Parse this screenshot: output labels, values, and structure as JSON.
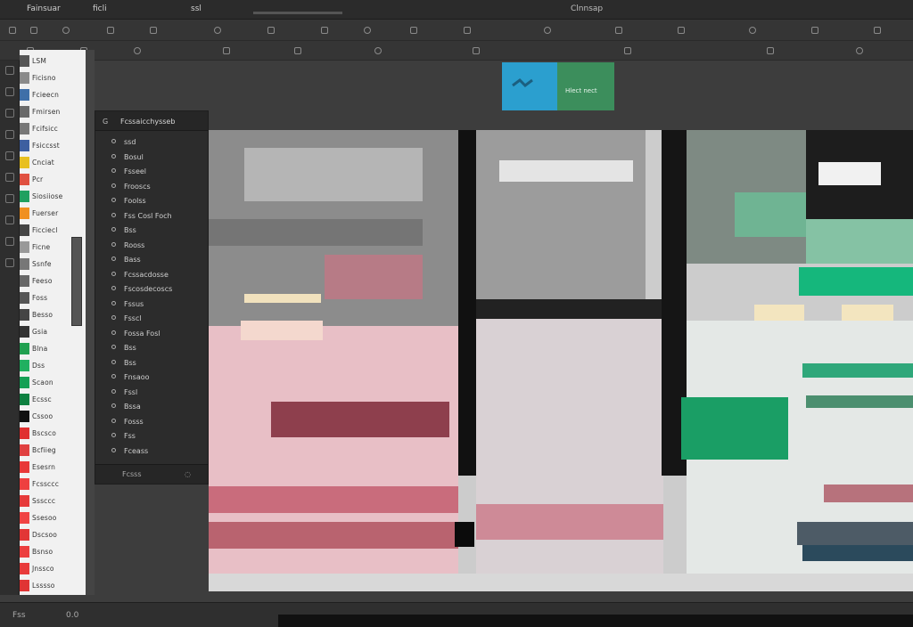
{
  "menubar": {
    "app_menu": "Fainsuar",
    "item_a": "ficli",
    "item_b": "ssl",
    "doc_title": "Clnnsap"
  },
  "toolbar": {
    "colors": {
      "bg": "#353535",
      "icon": "#8a8a8a"
    }
  },
  "top_badges": {
    "blue_icon": "wave-icon",
    "green_label": "Hlect nect",
    "colors": {
      "blue": "#2b9fcf",
      "green": "#3c8e5c"
    }
  },
  "swatches": [
    {
      "label": "LSM",
      "color": "#555555"
    },
    {
      "label": "Ficisno",
      "color": "#8a8a8a"
    },
    {
      "label": "Fcieecn",
      "color": "#3f6fa8"
    },
    {
      "label": "Fmirsen",
      "color": "#6a6a6a"
    },
    {
      "label": "Fcifsicc",
      "color": "#777777"
    },
    {
      "label": "Fsiccsst",
      "color": "#3d5fa0"
    },
    {
      "label": "Cnciat",
      "color": "#e8c020"
    },
    {
      "label": "Pcr",
      "color": "#e05040"
    },
    {
      "label": "Siosiiose",
      "color": "#20a060"
    },
    {
      "label": "Fuerser",
      "color": "#f09020"
    },
    {
      "label": "Ficciecl",
      "color": "#444444"
    },
    {
      "label": "Ficne",
      "color": "#999999"
    },
    {
      "label": "Ssnfe",
      "color": "#777777"
    },
    {
      "label": "Feeso",
      "color": "#666666"
    },
    {
      "label": "Foss",
      "color": "#555555"
    },
    {
      "label": "Besso",
      "color": "#444444"
    },
    {
      "label": "Gsia",
      "color": "#333333"
    },
    {
      "label": "Blna",
      "color": "#20a050"
    },
    {
      "label": "Dss",
      "color": "#20b060"
    },
    {
      "label": "Scaon",
      "color": "#15a055"
    },
    {
      "label": "Ecssc",
      "color": "#0d8040"
    },
    {
      "label": "Cssoo",
      "color": "#111111"
    },
    {
      "label": "Bscsco",
      "color": "#e03030"
    },
    {
      "label": "Bcfiieg",
      "color": "#e04040"
    },
    {
      "label": "Esesrn",
      "color": "#e83838"
    },
    {
      "label": "Fcssccc",
      "color": "#ee4040"
    },
    {
      "label": "Sssccc",
      "color": "#e63a3a"
    },
    {
      "label": "Ssesoo",
      "color": "#f04444"
    },
    {
      "label": "Dscsoo",
      "color": "#e23636"
    },
    {
      "label": "Bsnso",
      "color": "#ec3e3e"
    },
    {
      "label": "Jnssco",
      "color": "#e83a3a"
    },
    {
      "label": "Lsssso",
      "color": "#e03434"
    }
  ],
  "layers": {
    "title": "Fcssaicchysseb",
    "close_glyph": "G",
    "items": [
      "ssd",
      "Bosul",
      "Fsseel",
      "Frooscs",
      "Foolss",
      "Fss Cosl Foch",
      "Bss",
      "Rooss",
      "Bass",
      "Fcssacdosse",
      "Fscosdecoscs",
      "Fssus",
      "Fsscl",
      "Fossa Fosl",
      "Bss",
      "Bss",
      "Fnsaoo",
      "Fssl",
      "Bssa",
      "Fosss",
      "Fss",
      "Fceass"
    ],
    "footer_label": "Fcsss"
  },
  "status": {
    "left": "Fss",
    "mid": "0.0"
  }
}
